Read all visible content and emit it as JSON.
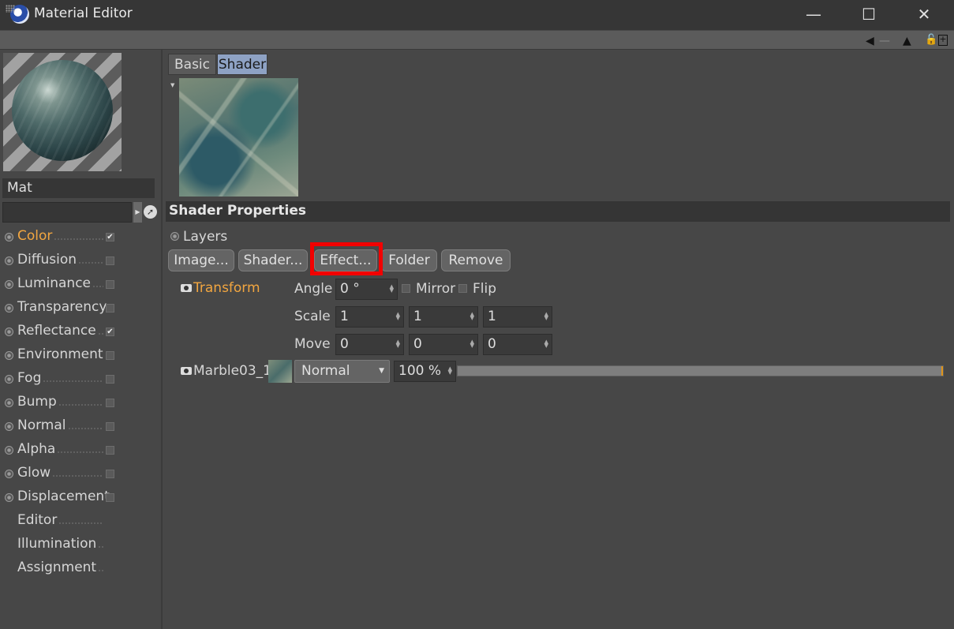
{
  "window": {
    "title": "Material Editor",
    "minimize": "—",
    "maximize": "☐",
    "close": "✕"
  },
  "toolbar": {
    "icons": [
      "grip-icon",
      "back-arrow-icon",
      "forward-arrow-icon",
      "up-arrow-icon",
      "lock-icon",
      "new-panel-icon"
    ]
  },
  "material": {
    "name": "Mat"
  },
  "channels": [
    {
      "label": "Color",
      "active": true,
      "checked": true,
      "has_radio": true
    },
    {
      "label": "Diffusion",
      "active": false,
      "checked": false,
      "has_radio": true
    },
    {
      "label": "Luminance",
      "active": false,
      "checked": false,
      "has_radio": true
    },
    {
      "label": "Transparency",
      "active": false,
      "checked": false,
      "has_radio": true
    },
    {
      "label": "Reflectance",
      "active": false,
      "checked": true,
      "has_radio": true
    },
    {
      "label": "Environment",
      "active": false,
      "checked": false,
      "has_radio": true
    },
    {
      "label": "Fog",
      "active": false,
      "checked": false,
      "has_radio": true
    },
    {
      "label": "Bump",
      "active": false,
      "checked": false,
      "has_radio": true
    },
    {
      "label": "Normal",
      "active": false,
      "checked": false,
      "has_radio": true
    },
    {
      "label": "Alpha",
      "active": false,
      "checked": false,
      "has_radio": true
    },
    {
      "label": "Glow",
      "active": false,
      "checked": false,
      "has_radio": true
    },
    {
      "label": "Displacement",
      "active": false,
      "checked": false,
      "has_radio": true
    },
    {
      "label": "Editor",
      "active": false,
      "checked": null,
      "has_radio": false
    },
    {
      "label": "Illumination",
      "active": false,
      "checked": null,
      "has_radio": false
    },
    {
      "label": "Assignment",
      "active": false,
      "checked": null,
      "has_radio": false
    }
  ],
  "tabs": {
    "basic": "Basic",
    "shader": "Shader",
    "selected": "Shader"
  },
  "shader_properties": {
    "title": "Shader Properties",
    "layers_label": "Layers",
    "buttons": {
      "image": "Image...",
      "shader": "Shader...",
      "effect": "Effect...",
      "folder": "Folder",
      "remove": "Remove"
    },
    "highlighted_button": "Effect...",
    "highlight_color": "#f20000"
  },
  "transform": {
    "label": "Transform",
    "angle_label": "Angle",
    "angle_value": "0 °",
    "mirror_label": "Mirror",
    "flip_label": "Flip",
    "scale_label": "Scale",
    "scale": [
      "1",
      "1",
      "1"
    ],
    "move_label": "Move",
    "move": [
      "0",
      "0",
      "0"
    ]
  },
  "layer": {
    "name": "Marble03_1",
    "blend_mode": "Normal",
    "opacity": "100 %",
    "opacity_fraction": 1.0
  },
  "colors": {
    "accent_orange": "#f2a640",
    "selected_tab": "#8ea2c4",
    "background": "#474747"
  }
}
